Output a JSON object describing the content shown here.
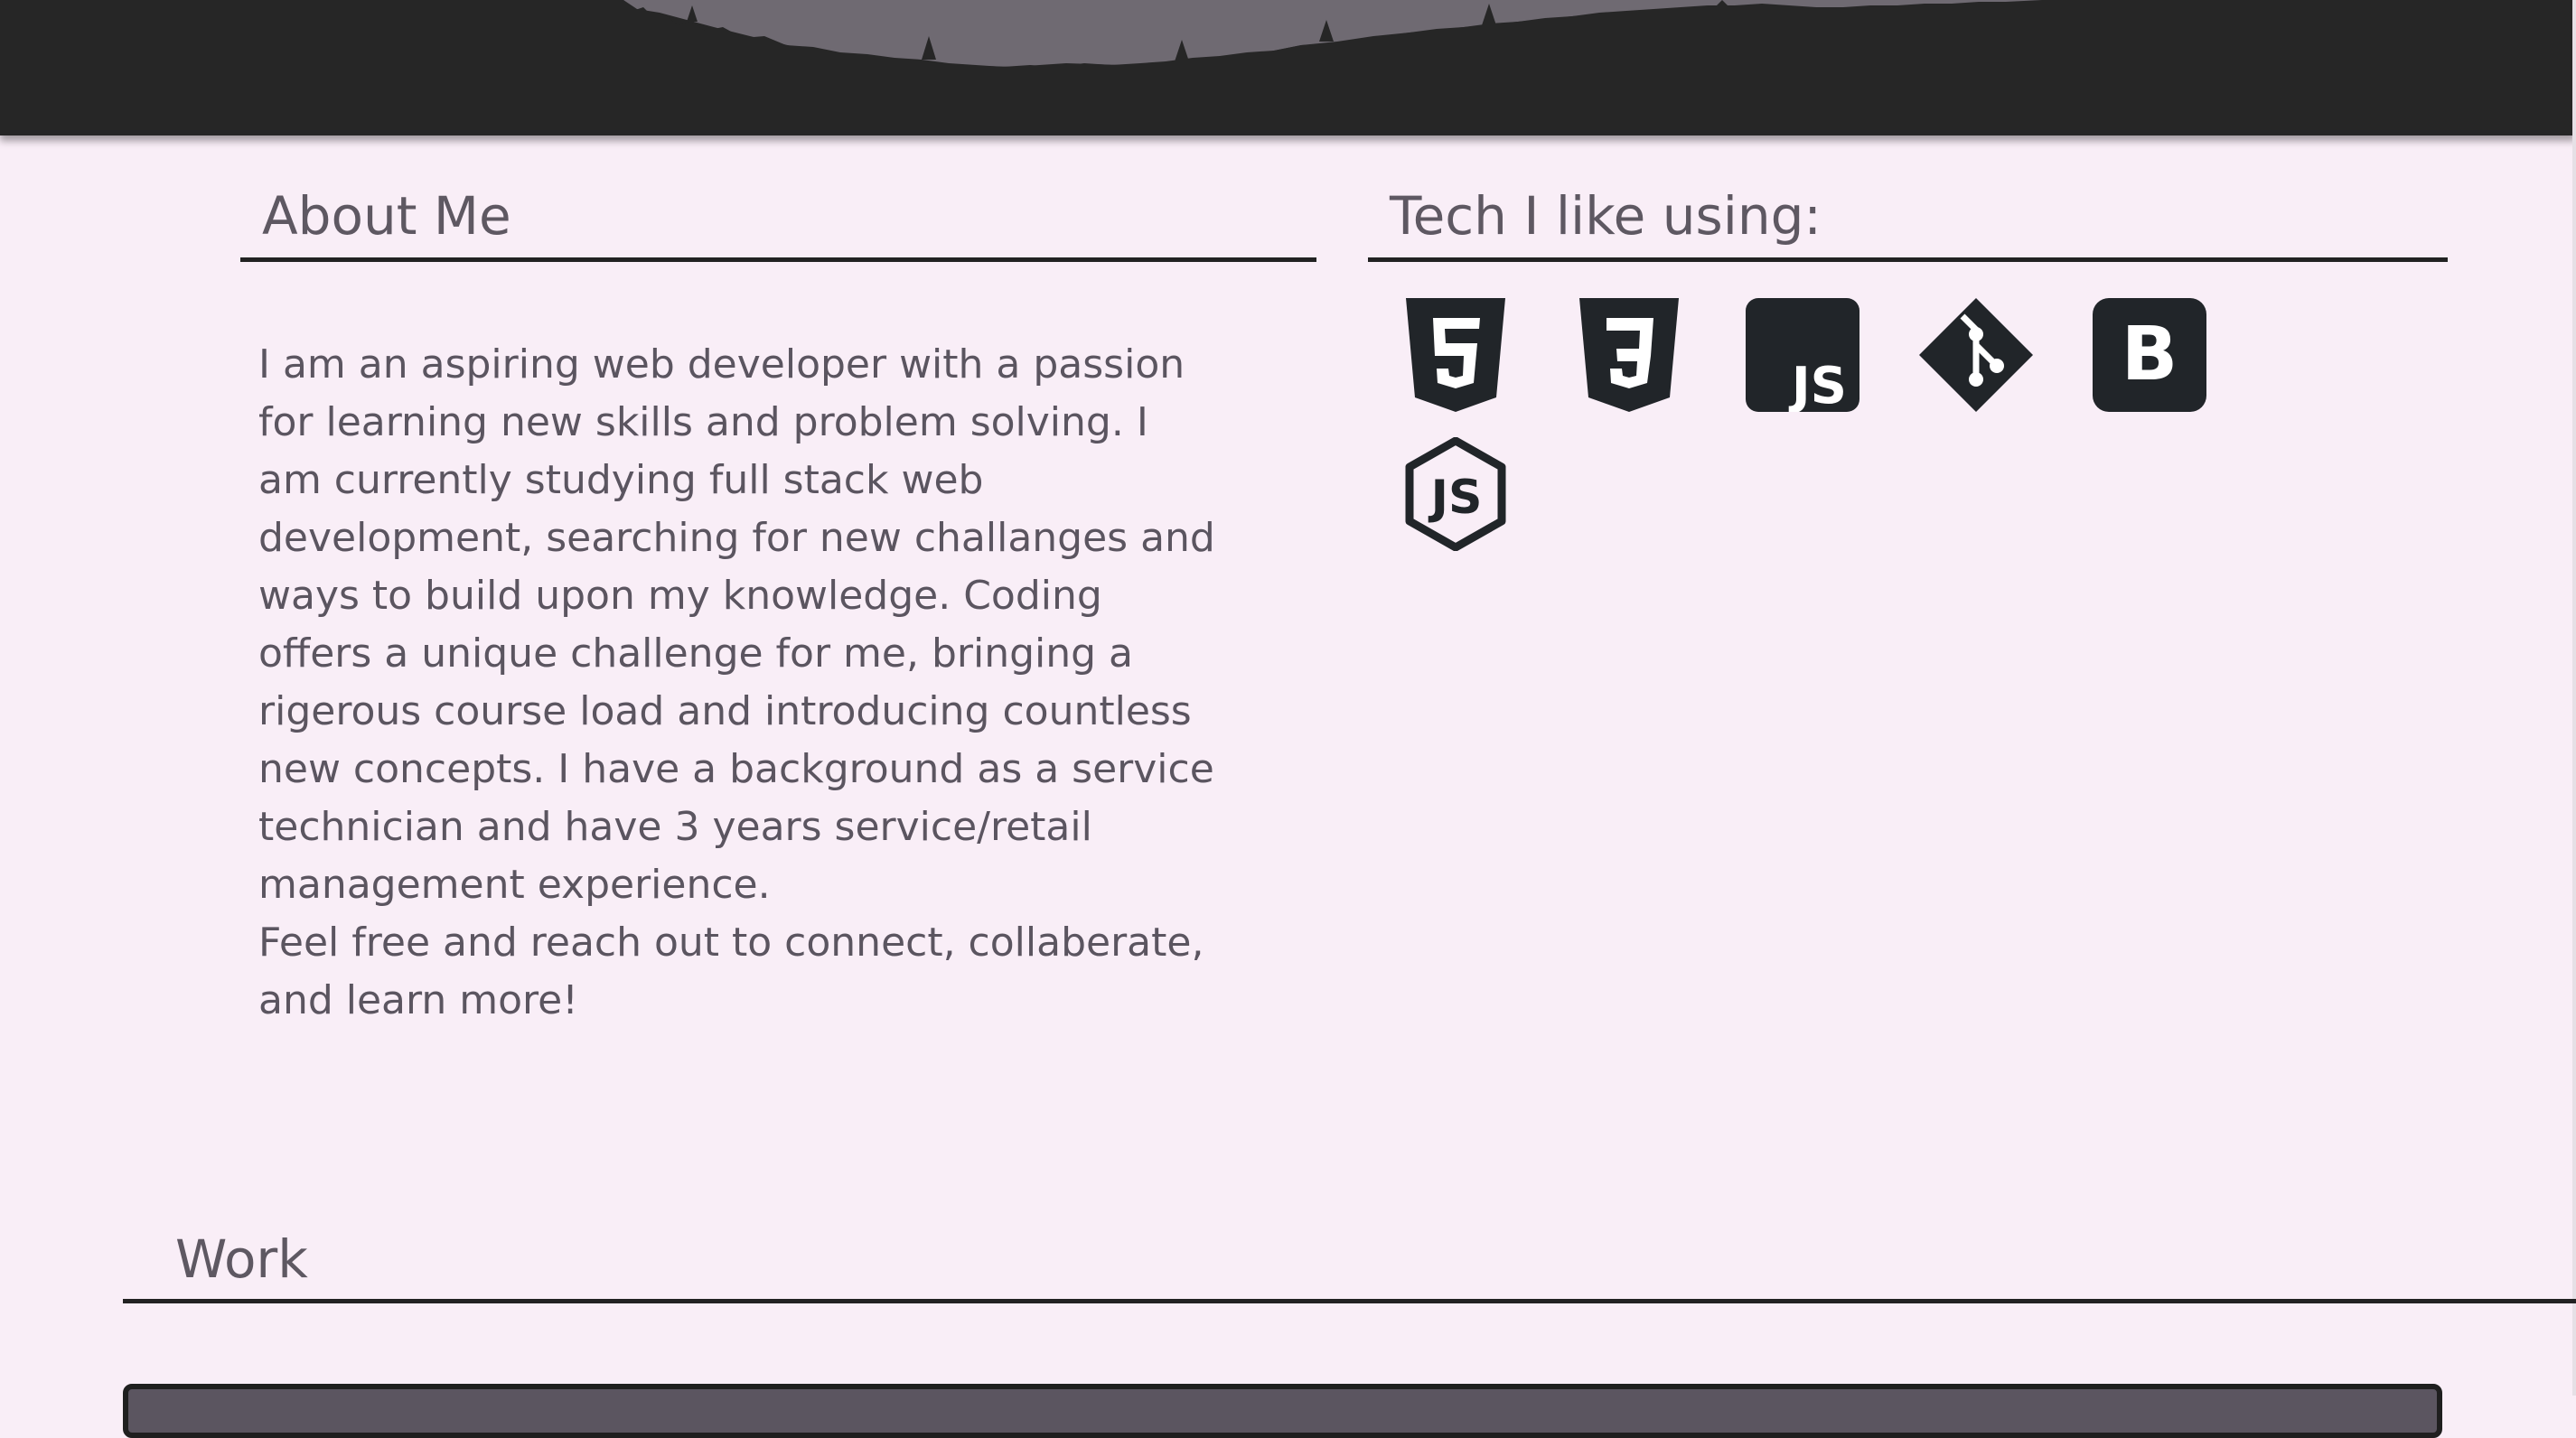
{
  "about": {
    "title": "About Me",
    "paragraph1": "I am an aspiring web developer with a passion for learning new skills and problem solving. I am currently studying full stack web development, searching for new challanges and ways to build upon my knowledge. Coding offers a unique challenge for me, bringing a rigerous course load and introducing countless new concepts. I have a background as a service technician and have 3 years service/retail management experience.",
    "paragraph2": "Feel free and reach out to connect, collaberate, and learn more!"
  },
  "tech": {
    "title": "Tech I like using:",
    "icons": [
      "html5-icon",
      "css3-icon",
      "javascript-icon",
      "git-icon",
      "bootstrap-icon",
      "nodejs-icon"
    ]
  },
  "work": {
    "title": "Work"
  },
  "colors": {
    "background": "#f9eef7",
    "header": "#262626",
    "text": "#5b5560",
    "icon": "#212529"
  }
}
